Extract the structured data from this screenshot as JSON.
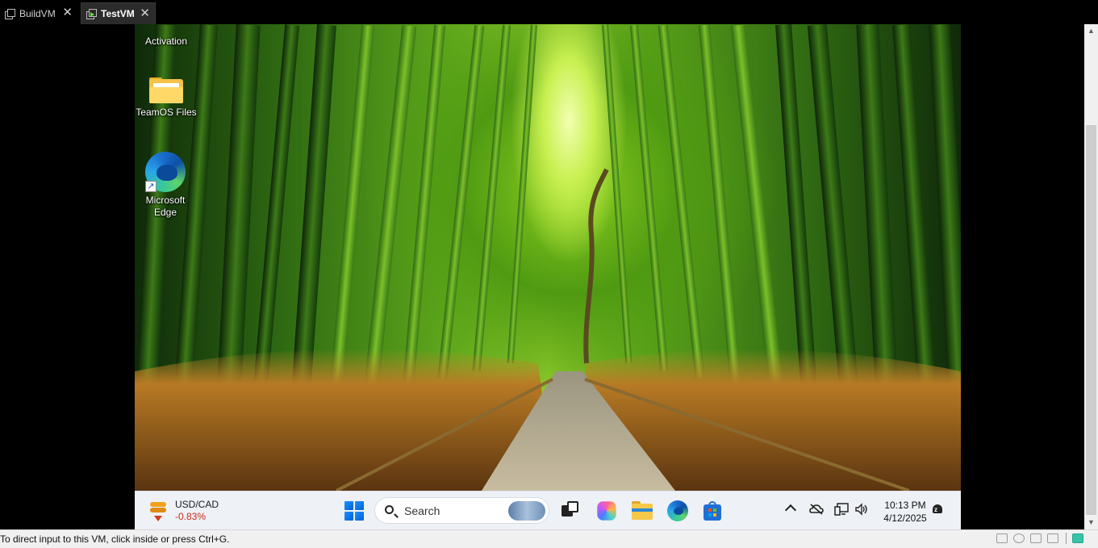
{
  "tabs": [
    {
      "label": "BuildVM",
      "close": "✕",
      "active": false
    },
    {
      "label": "TestVM",
      "close": "✕",
      "active": true
    }
  ],
  "desktop": {
    "icons": [
      {
        "label": "Activation"
      },
      {
        "label": "TeamOS Files"
      },
      {
        "label": "Microsoft Edge",
        "line1": "Microsoft",
        "line2": "Edge"
      }
    ]
  },
  "taskbar": {
    "widget": {
      "pair": "USD/CAD",
      "change": "-0.83%",
      "change_color": "#c42b1c"
    },
    "search_placeholder": "Search",
    "apps": [
      "start-icon",
      "task-view-icon",
      "copilot-icon",
      "file-explorer-icon",
      "edge-icon",
      "store-icon"
    ],
    "tray_icons": [
      "chevron-up-icon",
      "onedrive-offline-icon",
      "network-icon",
      "volume-icon"
    ],
    "clock": {
      "time": "10:13 PM",
      "date": "4/12/2025"
    },
    "notification_icon": "notification-bell-icon"
  },
  "statusbar": {
    "message": "To direct input to this VM, click inside or press Ctrl+G.",
    "icons": [
      "hdd-icon",
      "cd-icon",
      "network-adapter-icon",
      "sound-icon",
      "message-icon"
    ]
  },
  "colors": {
    "accent": "#0067c0",
    "taskbar_bg": "#eef1f6",
    "statusbar_bg": "#f0f0f0"
  }
}
